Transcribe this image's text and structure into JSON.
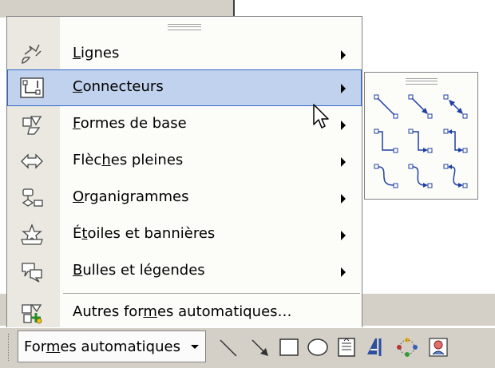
{
  "menu": {
    "items": [
      {
        "pre": "",
        "mnemonic": "L",
        "post": "ignes",
        "icon": "lines-icon"
      },
      {
        "pre": "",
        "mnemonic": "C",
        "post": "onnecteurs",
        "icon": "connectors-icon"
      },
      {
        "pre": "",
        "mnemonic": "F",
        "post": "ormes de base",
        "icon": "basic-shapes-icon"
      },
      {
        "pre": "Flèc",
        "mnemonic": "h",
        "post": "es pleines",
        "icon": "block-arrows-icon"
      },
      {
        "pre": "",
        "mnemonic": "O",
        "post": "rganigrammes",
        "icon": "flowchart-icon"
      },
      {
        "pre": "É",
        "mnemonic": "t",
        "post": "oiles et bannières",
        "icon": "stars-banners-icon"
      },
      {
        "pre": "",
        "mnemonic": "B",
        "post": "ulles et légendes",
        "icon": "callouts-icon"
      },
      {
        "pre": "Autres for",
        "mnemonic": "m",
        "post": "es automatiques…",
        "icon": "more-autoshapes-icon"
      }
    ]
  },
  "toolbar": {
    "autoshapes_pre": "For",
    "autoshapes_mnemonic": "m",
    "autoshapes_post": "es automatiques",
    "buttons": [
      "line-icon",
      "arrow-icon",
      "rectangle-icon",
      "oval-icon",
      "textbox-icon",
      "wordart-icon",
      "diagram-icon",
      "clipart-icon"
    ]
  },
  "colors": {
    "highlight": "#c1d2ee",
    "highlight_border": "#316ac5",
    "menu_bg": "#fcfcf9",
    "gutter": "#eae8e1",
    "toolbar": "#d4d0c8",
    "connector_blue": "#1f3fa0"
  }
}
